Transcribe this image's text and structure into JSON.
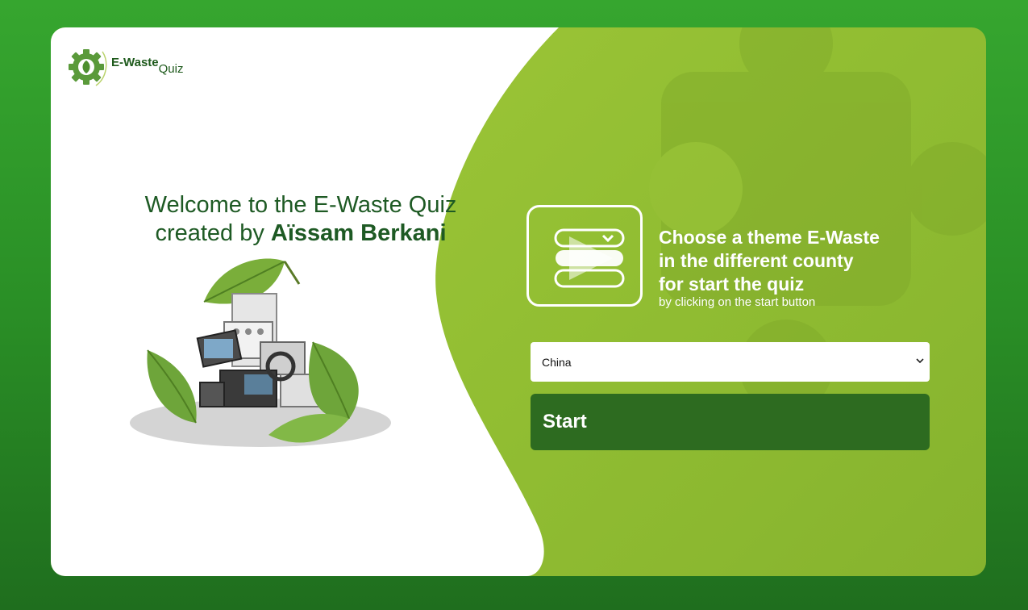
{
  "logo": {
    "brand": "E-Waste",
    "sub": "Quiz",
    "icon": "gear-leaf-icon"
  },
  "welcome": {
    "line1": "Welcome to the E-Waste Quiz",
    "line2_prefix": "created by ",
    "author": "Aïssam Berkani"
  },
  "theme": {
    "icon": "theme-select-icon",
    "headline": [
      "Choose a theme E-Waste",
      "in the different county",
      "for start the quiz"
    ],
    "subline": "by clicking on the start button"
  },
  "country_select": {
    "selected": "China"
  },
  "start_button": {
    "label": "Start"
  },
  "colors": {
    "page_bg": "#2a8f26",
    "panel_green": "#93bf33",
    "dark_green": "#2d6b20",
    "text_green": "#1e5a24"
  }
}
